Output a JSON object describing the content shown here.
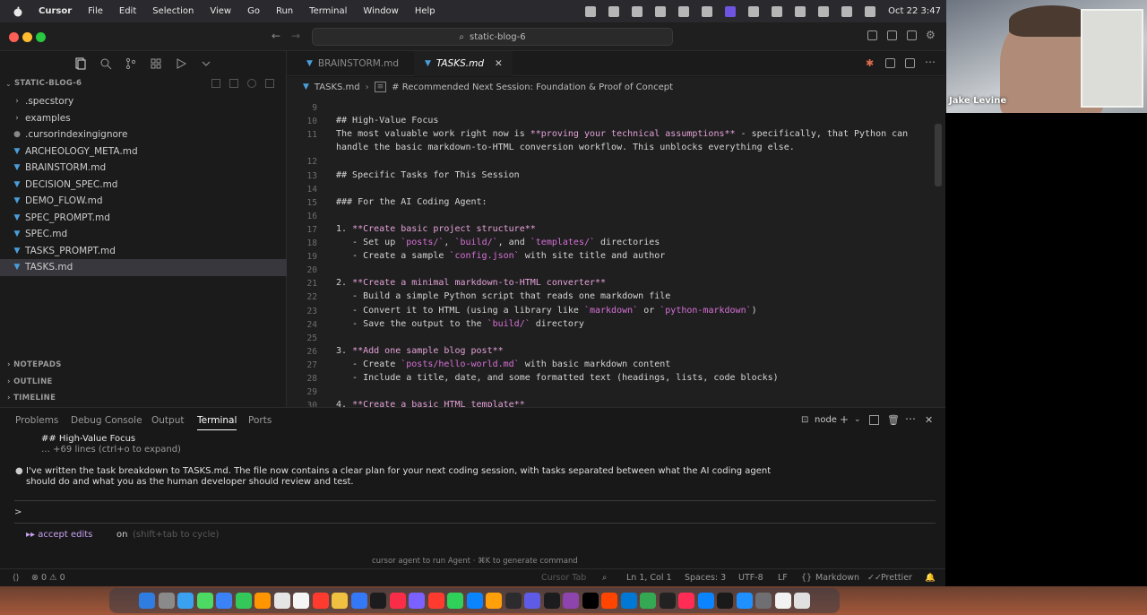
{
  "menubar": {
    "app": "Cursor",
    "items": [
      "File",
      "Edit",
      "Selection",
      "View",
      "Go",
      "Run",
      "Terminal",
      "Window",
      "Help"
    ],
    "datetime": "Oct 22  3:47"
  },
  "window": {
    "search": "static-blog-6"
  },
  "sidebar": {
    "section": "STATIC-BLOG-6",
    "files": [
      {
        "name": ".specstory",
        "kind": "folder"
      },
      {
        "name": "examples",
        "kind": "folder"
      },
      {
        "name": ".cursorindexingignore",
        "kind": "config"
      },
      {
        "name": "ARCHEOLOGY_META.md",
        "kind": "md"
      },
      {
        "name": "BRAINSTORM.md",
        "kind": "md"
      },
      {
        "name": "DECISION_SPEC.md",
        "kind": "md"
      },
      {
        "name": "DEMO_FLOW.md",
        "kind": "md"
      },
      {
        "name": "SPEC_PROMPT.md",
        "kind": "md"
      },
      {
        "name": "SPEC.md",
        "kind": "md"
      },
      {
        "name": "TASKS_PROMPT.md",
        "kind": "md"
      },
      {
        "name": "TASKS.md",
        "kind": "md",
        "active": true
      }
    ],
    "panels": [
      "NOTEPADS",
      "OUTLINE",
      "TIMELINE"
    ]
  },
  "tabs": [
    {
      "label": "BRAINSTORM.md",
      "active": false
    },
    {
      "label": "TASKS.md",
      "active": true
    }
  ],
  "breadcrumb": {
    "file": "TASKS.md",
    "symbol": "# Recommended Next Session: Foundation & Proof of Concept"
  },
  "editor": {
    "lines": [
      {
        "n": "9",
        "segments": []
      },
      {
        "n": "10",
        "segments": [
          {
            "t": "## High-Value Focus",
            "s": "n"
          }
        ]
      },
      {
        "n": "11",
        "segments": [
          {
            "t": "The most valuable work right now is ",
            "s": "n"
          },
          {
            "t": "**proving your technical assumptions**",
            "s": "b"
          },
          {
            "t": " - specifically, that Python can",
            "s": "n"
          }
        ]
      },
      {
        "n": "",
        "segments": [
          {
            "t": "handle the basic markdown-to-HTML conversion workflow. This unblocks everything else.",
            "s": "n"
          }
        ]
      },
      {
        "n": "12",
        "segments": []
      },
      {
        "n": "13",
        "segments": [
          {
            "t": "## Specific Tasks for This Session",
            "s": "n"
          }
        ]
      },
      {
        "n": "14",
        "segments": []
      },
      {
        "n": "15",
        "segments": [
          {
            "t": "### For the AI Coding Agent:",
            "s": "n"
          }
        ]
      },
      {
        "n": "16",
        "segments": []
      },
      {
        "n": "17",
        "segments": [
          {
            "t": "1. ",
            "s": "n"
          },
          {
            "t": "**Create basic project structure**",
            "s": "b"
          }
        ]
      },
      {
        "n": "18",
        "segments": [
          {
            "t": "   - Set up ",
            "s": "n"
          },
          {
            "t": "`posts/`",
            "s": "p"
          },
          {
            "t": ", ",
            "s": "n"
          },
          {
            "t": "`build/`",
            "s": "p"
          },
          {
            "t": ", and ",
            "s": "n"
          },
          {
            "t": "`templates/`",
            "s": "p"
          },
          {
            "t": " directories",
            "s": "n"
          }
        ]
      },
      {
        "n": "19",
        "segments": [
          {
            "t": "   - Create a sample ",
            "s": "n"
          },
          {
            "t": "`config.json`",
            "s": "p"
          },
          {
            "t": " with site title and author",
            "s": "n"
          }
        ]
      },
      {
        "n": "20",
        "segments": []
      },
      {
        "n": "21",
        "segments": [
          {
            "t": "2. ",
            "s": "n"
          },
          {
            "t": "**Create a minimal markdown-to-HTML converter**",
            "s": "b"
          }
        ]
      },
      {
        "n": "22",
        "segments": [
          {
            "t": "   - Build a simple Python script that reads one markdown file",
            "s": "n"
          }
        ]
      },
      {
        "n": "23",
        "segments": [
          {
            "t": "   - Convert it to HTML (using a library like ",
            "s": "n"
          },
          {
            "t": "`markdown`",
            "s": "p"
          },
          {
            "t": " or ",
            "s": "n"
          },
          {
            "t": "`python-markdown`",
            "s": "p"
          },
          {
            "t": ")",
            "s": "n"
          }
        ]
      },
      {
        "n": "24",
        "segments": [
          {
            "t": "   - Save the output to the ",
            "s": "n"
          },
          {
            "t": "`build/`",
            "s": "p"
          },
          {
            "t": " directory",
            "s": "n"
          }
        ]
      },
      {
        "n": "25",
        "segments": []
      },
      {
        "n": "26",
        "segments": [
          {
            "t": "3. ",
            "s": "n"
          },
          {
            "t": "**Add one sample blog post**",
            "s": "b"
          }
        ]
      },
      {
        "n": "27",
        "segments": [
          {
            "t": "   - Create ",
            "s": "n"
          },
          {
            "t": "`posts/hello-world.md`",
            "s": "p"
          },
          {
            "t": " with basic markdown content",
            "s": "n"
          }
        ]
      },
      {
        "n": "28",
        "segments": [
          {
            "t": "   - Include a title, date, and some formatted text (headings, lists, code blocks)",
            "s": "n"
          }
        ]
      },
      {
        "n": "29",
        "segments": []
      },
      {
        "n": "30",
        "segments": [
          {
            "t": "4. ",
            "s": "n"
          },
          {
            "t": "**Create a basic HTML template**",
            "s": "b"
          }
        ]
      }
    ]
  },
  "panel": {
    "tabs": [
      "Problems",
      "Debug Console",
      "Output",
      "Terminal",
      "Ports"
    ],
    "active_tab": "Terminal",
    "shell": "node",
    "output_heading": "## High-Value Focus",
    "output_collapsed": "… +69 lines (ctrl+o to expand)",
    "message_line1": "I've written the task breakdown to TASKS.md. The file now contains a clear plan for your next coding session, with tasks separated between what the AI coding agent",
    "message_line2": "should do and what you as the human developer should review and test.",
    "prompt_symbol": ">",
    "mode_prefix": "▸▸ accept edits",
    "mode_on": "on",
    "mode_hint": "(shift+tab to cycle)",
    "hint": "cursor agent to run Agent · ⌘K to generate command"
  },
  "statusbar": {
    "problems": "⊗ 0 ⚠ 0",
    "cursor_tab": "Cursor Tab",
    "position": "Ln 1, Col 1",
    "spaces": "Spaces: 3",
    "encoding": "UTF-8",
    "eol": "LF",
    "language": "Markdown",
    "formatter": "Prettier"
  },
  "webcam": {
    "name": "Jake Levine"
  },
  "colors": {
    "accent": "#0078d4",
    "md_icon": "#4a9eda",
    "bold_md": "#e3a0d8",
    "code_md": "#d670d6"
  }
}
